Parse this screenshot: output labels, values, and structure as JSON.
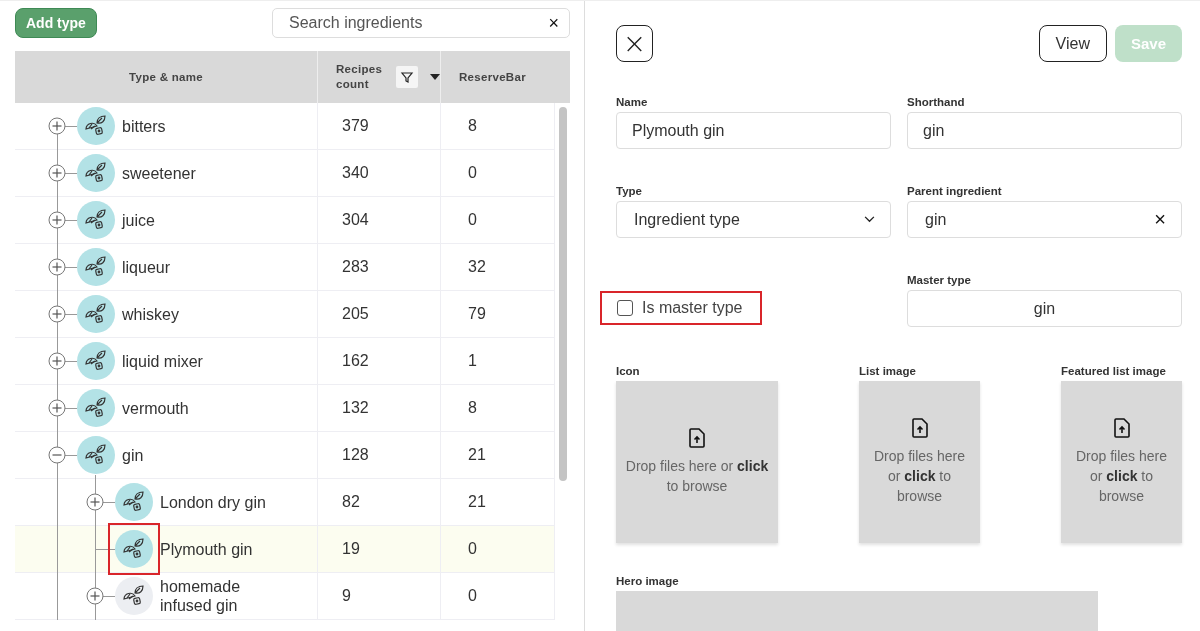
{
  "toolbar": {
    "add_button": "Add type",
    "search": {
      "placeholder": "Search ingredients",
      "clear": "×"
    }
  },
  "table": {
    "columns": [
      {
        "label": "Type & name",
        "filter": false
      },
      {
        "label": "Recipes count",
        "filter": true
      },
      {
        "label": "ReserveBar",
        "filter": false
      }
    ],
    "rows": [
      {
        "name": "bitters",
        "recipes": "379",
        "reservebar": "8",
        "kind": "branch",
        "expanded": false,
        "selected": false,
        "annotated": false,
        "color": "#b3e2e6"
      },
      {
        "name": "sweetener",
        "recipes": "340",
        "reservebar": "0",
        "kind": "branch",
        "expanded": false,
        "selected": false,
        "annotated": false,
        "color": "#b3e2e6"
      },
      {
        "name": "juice",
        "recipes": "304",
        "reservebar": "0",
        "kind": "branch",
        "expanded": false,
        "selected": false,
        "annotated": false,
        "color": "#b3e2e6"
      },
      {
        "name": "liqueur",
        "recipes": "283",
        "reservebar": "32",
        "kind": "branch",
        "expanded": false,
        "selected": false,
        "annotated": false,
        "color": "#b3e2e6"
      },
      {
        "name": "whiskey",
        "recipes": "205",
        "reservebar": "79",
        "kind": "branch",
        "expanded": false,
        "selected": false,
        "annotated": false,
        "color": "#b3e2e6"
      },
      {
        "name": "liquid mixer",
        "recipes": "162",
        "reservebar": "1",
        "kind": "branch",
        "expanded": false,
        "selected": false,
        "annotated": false,
        "color": "#b3e2e6"
      },
      {
        "name": "vermouth",
        "recipes": "132",
        "reservebar": "8",
        "kind": "branch",
        "expanded": false,
        "selected": false,
        "annotated": false,
        "color": "#b3e2e6"
      },
      {
        "name": "gin",
        "recipes": "128",
        "reservebar": "21",
        "kind": "branch",
        "expanded": true,
        "selected": false,
        "annotated": false,
        "color": "#b3e2e6",
        "children": [
          {
            "name": "London dry gin",
            "recipes": "82",
            "reservebar": "21",
            "kind": "branch",
            "expanded": false,
            "selected": false,
            "annotated": false,
            "color": "#b3e2e6"
          },
          {
            "name": "Plymouth gin",
            "recipes": "19",
            "reservebar": "0",
            "kind": "leaf",
            "selected": true,
            "annotated": true,
            "color": "#b3e2e6"
          },
          {
            "name": "homemade infused gin",
            "recipes": "9",
            "reservebar": "0",
            "kind": "branch",
            "expanded": false,
            "selected": false,
            "annotated": false,
            "color": "#eceef2"
          }
        ]
      }
    ]
  },
  "editor": {
    "close": "×",
    "view_button": "View",
    "save_button": {
      "label": "Save",
      "disabled": true
    },
    "name": {
      "label": "Name",
      "value": "Plymouth gin"
    },
    "shorthand": {
      "label": "Shorthand",
      "value": "gin"
    },
    "type": {
      "label": "Type",
      "value": "Ingredient type"
    },
    "parent": {
      "label": "Parent ingredient",
      "value": "gin",
      "clear": "×"
    },
    "master_checkbox": {
      "label": "Is master type",
      "checked": false,
      "annotated": true
    },
    "master_type": {
      "label": "Master type",
      "value": "gin"
    },
    "uploads": [
      {
        "label": "Icon",
        "text": "Drop files here or **click** to browse"
      },
      {
        "label": "List image",
        "text": "Drop files here or **click** to browse"
      },
      {
        "label": "Featured list image",
        "text": "Drop files here or **click** to browse"
      }
    ],
    "hero": {
      "label": "Hero image"
    }
  }
}
